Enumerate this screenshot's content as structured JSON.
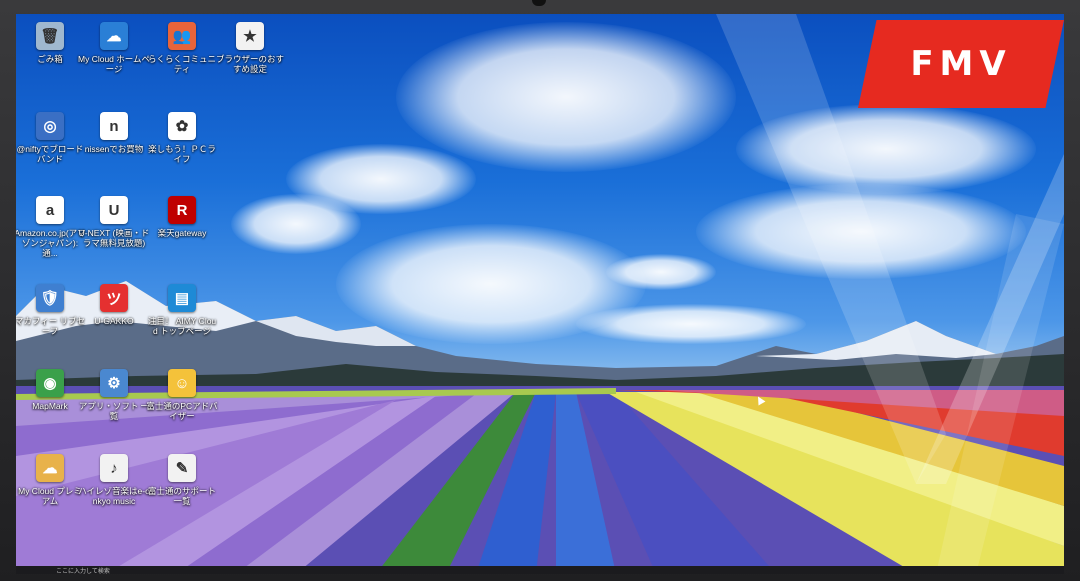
{
  "brand": {
    "logo_text": "FMV",
    "logo_color": "#e62a20"
  },
  "desktop": {
    "icons": [
      {
        "label": "ごみ箱",
        "glyph": "🗑",
        "bg": "#9fb8cf",
        "icon": "recycle-bin-icon"
      },
      {
        "label": "My Cloud ホームページ",
        "glyph": "☁",
        "bg": "#2a7fd6",
        "icon": "cloud-icon"
      },
      {
        "label": "らくらくコミュニティ",
        "glyph": "👥",
        "bg": "#e8643a",
        "icon": "community-icon"
      },
      {
        "label": "ブラウザーのおすすめ設定",
        "glyph": "★",
        "bg": "#f2f2f2",
        "icon": "browser-settings-icon"
      },
      {
        "label": "@niftyでブロードバンド",
        "glyph": "◎",
        "bg": "#3a6fc4",
        "icon": "nifty-icon"
      },
      {
        "label": "nissenでお買物",
        "glyph": "n",
        "bg": "#ffffff",
        "icon": "nissen-icon"
      },
      {
        "label": "楽しもう！ＰＣライフ",
        "glyph": "✿",
        "bg": "#ffffff",
        "icon": "pc-life-icon"
      },
      {
        "label": "Amazon.co.jp(アマゾンジャパン): 通...",
        "glyph": "a",
        "bg": "#ffffff",
        "icon": "amazon-icon"
      },
      {
        "label": "U-NEXT (映画・ドラマ無料見放題)",
        "glyph": "U",
        "bg": "#ffffff",
        "icon": "unext-icon"
      },
      {
        "label": "楽天gateway",
        "glyph": "R",
        "bg": "#bf0000",
        "icon": "rakuten-icon"
      },
      {
        "label": "マカフィー リブセーフ",
        "glyph": "🛡",
        "bg": "#3f7fd0",
        "icon": "security-icon"
      },
      {
        "label": "U-GAKKO",
        "glyph": "ツ",
        "bg": "#e53030",
        "icon": "ugakko-icon"
      },
      {
        "label": "注目！ AIMY Cloud トップページ",
        "glyph": "▤",
        "bg": "#1e8ad6",
        "icon": "aimy-cloud-icon"
      },
      {
        "label": "MapMark",
        "glyph": "◉",
        "bg": "#3aa04a",
        "icon": "map-icon"
      },
      {
        "label": "アプリ・ソフト 一覧",
        "glyph": "⚙",
        "bg": "#4a88d0",
        "icon": "apps-icon"
      },
      {
        "label": "富士通のPCアドバイザー",
        "glyph": "☺",
        "bg": "#f4c23a",
        "icon": "advisor-icon"
      },
      {
        "label": "My Cloud プレミアム",
        "glyph": "☁",
        "bg": "#e8b24a",
        "icon": "cloud-premium-icon"
      },
      {
        "label": "ハイレゾ音楽はe-onkyo music",
        "glyph": "♪",
        "bg": "#f2f2f2",
        "icon": "music-icon"
      },
      {
        "label": "富士通のサポート一覧",
        "glyph": "✎",
        "bg": "#f2f2f2",
        "icon": "support-icon"
      }
    ]
  },
  "taskbar": {
    "search_placeholder": "ここに入力して検索"
  }
}
